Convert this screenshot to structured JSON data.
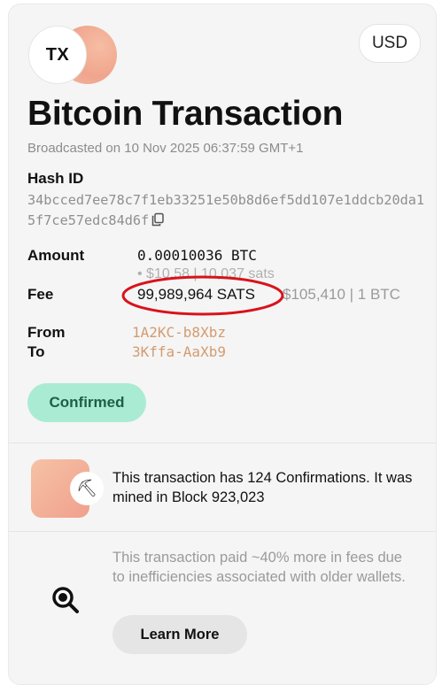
{
  "header": {
    "badge_label": "TX",
    "currency_button": "USD",
    "title": "Bitcoin Transaction",
    "broadcast_text": "Broadcasted on 10 Nov 2025 06:37:59 GMT+1"
  },
  "hash": {
    "label": "Hash ID",
    "value": "34bcced7ee78c7f1eb33251e50b8d6ef5dd107e1ddcb20da15f7ce57edc84d6f",
    "copy_icon": "copy-icon"
  },
  "amount": {
    "label": "Amount",
    "value": "0.00010036 BTC",
    "sub": "• $10.58 | 10,037 sats"
  },
  "fee": {
    "label": "Fee",
    "value": "99,989,964 SATS",
    "sub": "$105,410 | 1 BTC",
    "highlight_color": "#d9121b"
  },
  "addresses": {
    "from_label": "From",
    "from_value": "1A2KC-b8Xbz",
    "to_label": "To",
    "to_value": "3Kffa-AaXb9",
    "link_color": "#d49b6f"
  },
  "status": {
    "label": "Confirmed",
    "color": "#a9ecd3"
  },
  "confirmations": {
    "icon": "pickaxe-icon",
    "text": "This transaction has 124 Confirmations. It was mined in Block 923,023"
  },
  "fee_note": {
    "icon": "magnifier-icon",
    "text": "This transaction paid ~40% more in fees due to inefficiencies associated with older wallets.",
    "button_label": "Learn More"
  }
}
